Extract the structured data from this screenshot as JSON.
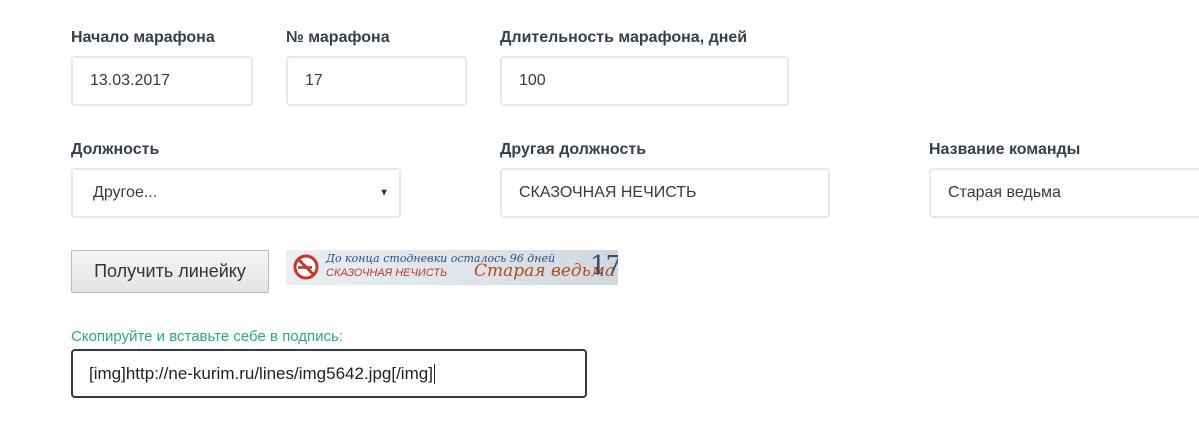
{
  "fields": {
    "marathon_start": {
      "label": "Начало марафона",
      "value": "13.03.2017"
    },
    "marathon_number": {
      "label": "№ марафона",
      "value": "17"
    },
    "marathon_duration": {
      "label": "Длительность марафона, дней",
      "value": "100"
    },
    "position": {
      "label": "Должность",
      "value": "Другое..."
    },
    "other_position": {
      "label": "Другая должность",
      "value": "СКАЗОЧНАЯ НЕЧИСТЬ"
    },
    "team_name": {
      "label": "Название команды",
      "value": "Старая ведьма"
    }
  },
  "get_line_button": "Получить линейку",
  "banner": {
    "days_left_text": "До конца стодневки осталось 96 дней",
    "position_text": "СКАЗОЧНАЯ НЕЧИСТЬ",
    "team_text": "Старая ведьма",
    "number_text": "17"
  },
  "copy_label": "Скопируйте и вставьте себе в подпись:",
  "code_value": "[img]http://ne-kurim.ru/lines/img5642.jpg[/img]",
  "colors": {
    "label": "#34404b",
    "input_border": "#e6e9ec",
    "copy_label": "#2aa88a",
    "active_border": "#2f3d4a"
  }
}
